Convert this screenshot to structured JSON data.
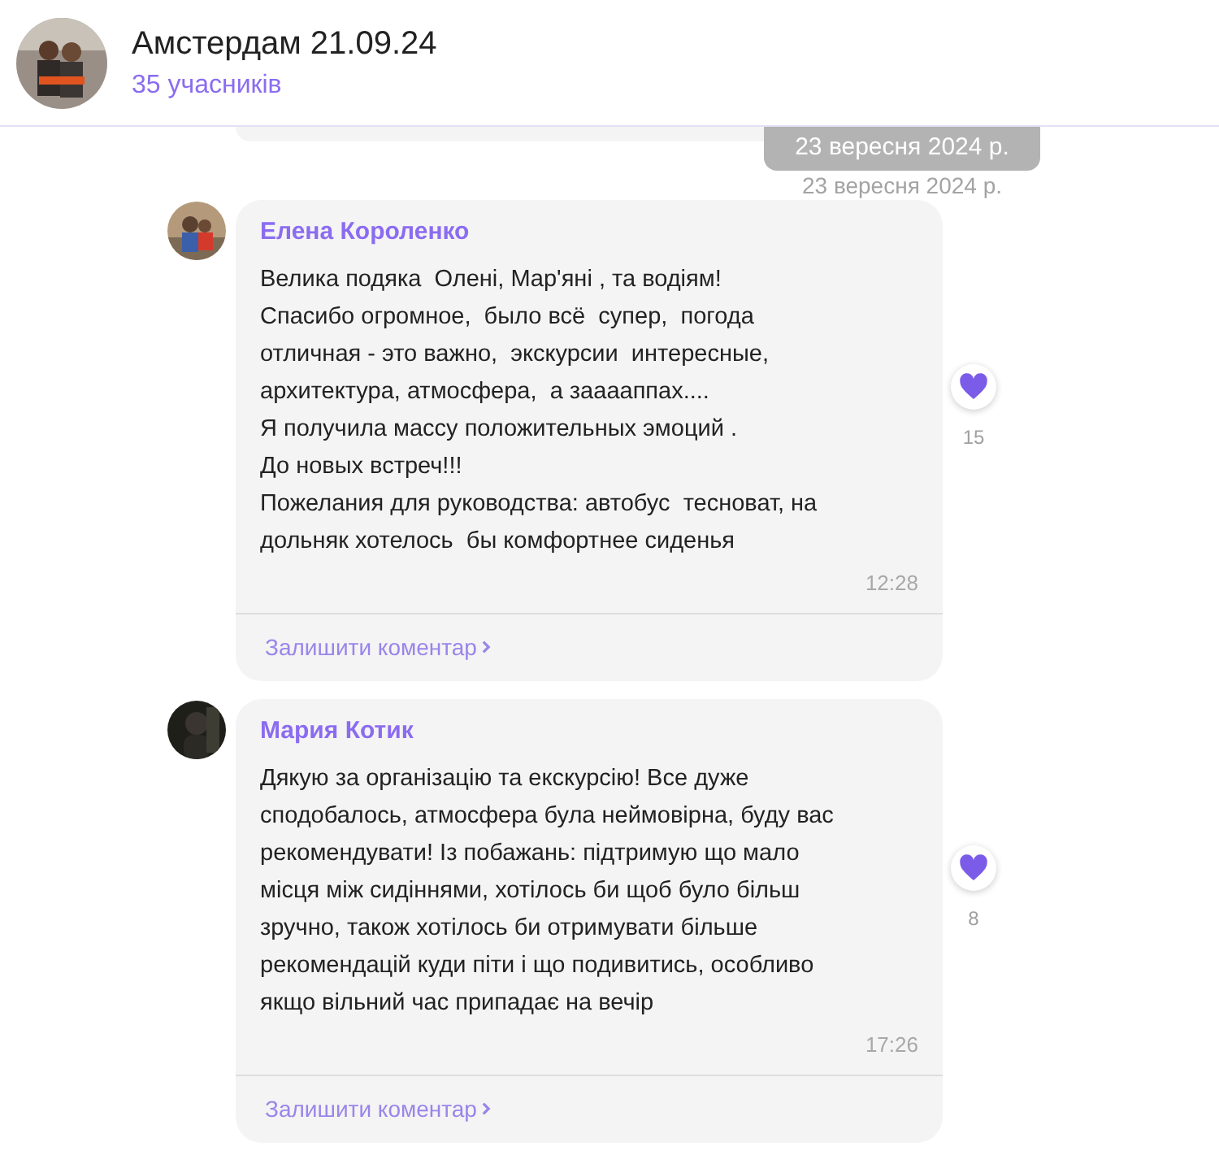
{
  "header": {
    "title": "Амстердам 21.09.24",
    "subtitle": "35 учасників"
  },
  "date_pill": "23 вересня 2024 р.",
  "date_shadow": "23 вересня 2024 р.",
  "messages": [
    {
      "author": "Елена Короленко",
      "text": "Велика подяка  Олені, Мар'яні , та водіям!\nСпасибо огромное,  было всё  супер,  погода\nотличная - это важно,  экскурсии  интересные,\nархитектура, атмосфера,  а зааааппах....\nЯ получила массу положительных эмоций .\nДо новых встреч!!!\nПожелания для руководства: автобус  тесноват, на\nдольняк хотелось  бы комфортнее сиденья",
      "time": "12:28",
      "comment_link": "Залишити коментар",
      "likes": "15",
      "liked": true
    },
    {
      "author": "Мария Котик",
      "text": "Дякую за організацію та екскурсію! Все дуже\nсподобалось, атмосфера була неймовірна, буду вас\nрекомендувати! Із побажань: підтримую що мало\nмісця між сидіннями, хотілось би щоб було більш\nзручно, також хотілось би отримувати більше\nрекомендацій куди піти і що подивитись, особливо\nякщо вільний час припадає на вечір",
      "time": "17:26",
      "comment_link": "Залишити коментар",
      "likes": "8",
      "liked": true
    }
  ]
}
